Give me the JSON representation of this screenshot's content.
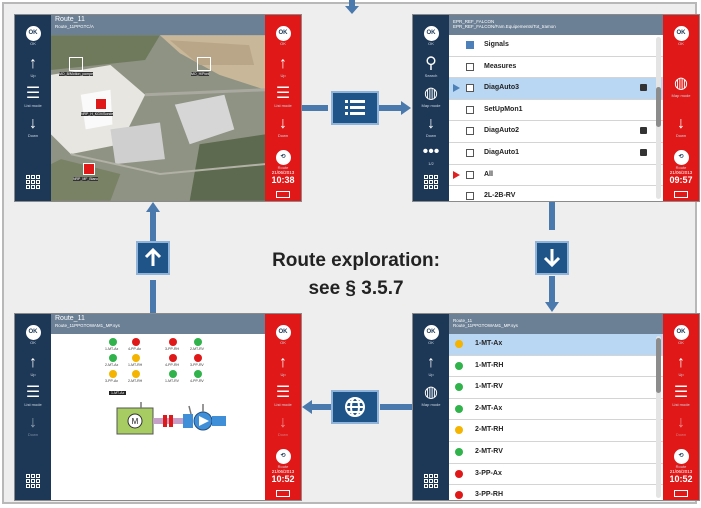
{
  "caption": {
    "line1": "Route exploration:",
    "line2": "see § 3.5.7"
  },
  "side_labels": {
    "ok": "OK",
    "up": "Up",
    "list_mode": "List mode",
    "down": "Down",
    "map_mode": "Map mode",
    "search": "Search",
    "more": "1/2",
    "route": "Route"
  },
  "icons": {
    "ok": "ok-button-icon",
    "up": "arrow-up-icon",
    "list": "list-mode-icon",
    "down": "arrow-down-icon",
    "map": "globe-icon",
    "search": "search-icon",
    "more": "more-icon",
    "route": "route-icon",
    "apps": "grid-menu-icon",
    "battery": "battery-icon"
  },
  "colors": {
    "side": "#1d3857",
    "title_bar": "#6b7f95",
    "selected_row": "#b9d6f3",
    "green": "#2fb34a",
    "yellow": "#f4b400",
    "red": "#e01818",
    "connector": "#4a79ad",
    "button": "#1f5489"
  },
  "screen_tl": {
    "title": "Route_11",
    "subtitle": "Route_11PPGTC/A",
    "date": "21/06/2013",
    "time": "10:38",
    "map_labels": [
      "MO_B/Motion_pompe",
      "MO_H/Pont",
      "NRP_H_KGV/Sonde",
      "NRP_MF_Blanc"
    ]
  },
  "screen_tr": {
    "title": "EPR_REF_FALCON",
    "subtitle": "EPR_REF_FALCON/Fam.Equipements/Tot_tramon",
    "date": "21/06/2013",
    "time": "09:57",
    "rows": [
      {
        "label": "Signals",
        "box": "checked",
        "marker": "",
        "bag": false,
        "selected": false
      },
      {
        "label": "Measures",
        "box": "empty",
        "marker": "",
        "bag": false,
        "selected": false
      },
      {
        "label": "DiagAuto3",
        "box": "empty",
        "marker": "blue",
        "bag": true,
        "selected": true
      },
      {
        "label": "SetUpMon1",
        "box": "empty",
        "marker": "",
        "bag": false,
        "selected": false
      },
      {
        "label": "DiagAuto2",
        "box": "empty",
        "marker": "",
        "bag": true,
        "selected": false
      },
      {
        "label": "DiagAuto1",
        "box": "empty",
        "marker": "",
        "bag": true,
        "selected": false
      },
      {
        "label": "All",
        "box": "empty",
        "marker": "red",
        "bag": false,
        "selected": false
      },
      {
        "label": "2L-2B-RV",
        "box": "empty",
        "marker": "",
        "bag": false,
        "selected": false
      }
    ]
  },
  "screen_bl": {
    "title": "Route_11",
    "subtitle": "Route_11PPGTOWAM1_MP.sys",
    "date": "21/06/2013",
    "time": "10:52",
    "lamps": [
      {
        "label": "1-MT-Ax",
        "color": "green"
      },
      {
        "label": "2-MT-Ax",
        "color": "green"
      },
      {
        "label": "3-PP-Ax",
        "color": "yellow"
      },
      {
        "label": "4-PP-Ax",
        "color": "red"
      },
      {
        "label": "1-MT-RH",
        "color": "yellow"
      },
      {
        "label": "2-MT-RH",
        "color": "yellow"
      },
      {
        "label": "3-PP-RH",
        "color": "red"
      },
      {
        "label": "4-PP-RH",
        "color": "red"
      },
      {
        "label": "1-MT-RV",
        "color": "green"
      },
      {
        "label": "2-MT-RV",
        "color": "green"
      },
      {
        "label": "3-PP-RV",
        "color": "red"
      },
      {
        "label": "4-PP-RV",
        "color": "green"
      }
    ],
    "tag": "1-MT-Ax",
    "motor": "M"
  },
  "screen_br": {
    "title": "Route_11",
    "subtitle": "Route_11PPGTOWAM1_MP.sys",
    "date": "21/06/2013",
    "time": "10:52",
    "rows": [
      {
        "label": "1-MT-Ax",
        "color": "yellow",
        "selected": true
      },
      {
        "label": "1-MT-RH",
        "color": "green",
        "selected": false
      },
      {
        "label": "1-MT-RV",
        "color": "green",
        "selected": false
      },
      {
        "label": "2-MT-Ax",
        "color": "green",
        "selected": false
      },
      {
        "label": "2-MT-RH",
        "color": "yellow",
        "selected": false
      },
      {
        "label": "2-MT-RV",
        "color": "green",
        "selected": false
      },
      {
        "label": "3-PP-Ax",
        "color": "red",
        "selected": false
      },
      {
        "label": "3-PP-RH",
        "color": "red",
        "selected": false
      }
    ]
  }
}
